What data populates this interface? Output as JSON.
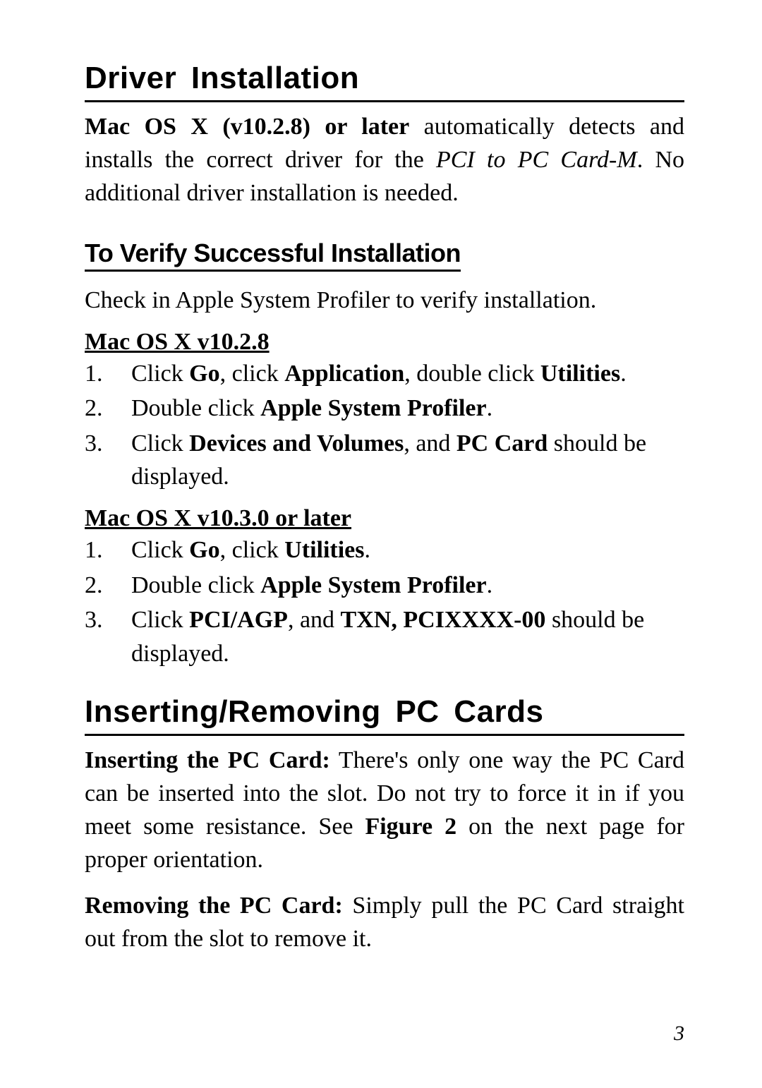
{
  "section1": {
    "title": "Driver  Installation",
    "intro": {
      "b1": "Mac OS X (v10.2.8) or later",
      "t1": " automatically detects and installs the correct driver for the ",
      "i1": "PCI to PC Card-M",
      "t2": ".  No additional driver installation is needed."
    },
    "verify": {
      "title": "To Verify Successful Installation",
      "lead": "Check in Apple System Profiler to verify installation.",
      "groupA": {
        "label": "Mac OS X v10.2.8",
        "items": [
          {
            "pre": "Click ",
            "b1": "Go",
            "mid1": ", click ",
            "b2": "Application",
            "mid2": ", double click ",
            "b3": "Utilities",
            "post": "."
          },
          {
            "pre": "Double click ",
            "b1": "Apple System Profiler",
            "post": "."
          },
          {
            "pre": "Click ",
            "b1": "Devices and Volumes",
            "mid1": ", and ",
            "b2": "PC Card",
            "post": " should be displayed."
          }
        ]
      },
      "groupB": {
        "label": "Mac OS X v10.3.0 or later",
        "items": [
          {
            "pre": "Click ",
            "b1": "Go",
            "mid1": ", click ",
            "b2": "Utilities",
            "post": "."
          },
          {
            "pre": "Double click ",
            "b1": "Apple System Profiler",
            "post": "."
          },
          {
            "pre": "Click ",
            "b1": "PCI/AGP",
            "mid1": ", and ",
            "b2": "TXN, PCIXXXX-00",
            "post": " should be displayed."
          }
        ]
      }
    }
  },
  "section2": {
    "title": "Inserting/Removing  PC  Cards",
    "p1": {
      "b1": "Inserting the PC Card:",
      "t1": "  There's only one way the PC Card can be inserted into the slot.  Do not try to force it in if you meet some resistance.  See ",
      "b2": "Figure 2",
      "t2": " on the next page for proper orientation."
    },
    "p2": {
      "b1": "Removing the PC Card:",
      "t1": "  Simply pull the PC Card straight out from the slot to remove it."
    }
  },
  "pageNumber": "3"
}
